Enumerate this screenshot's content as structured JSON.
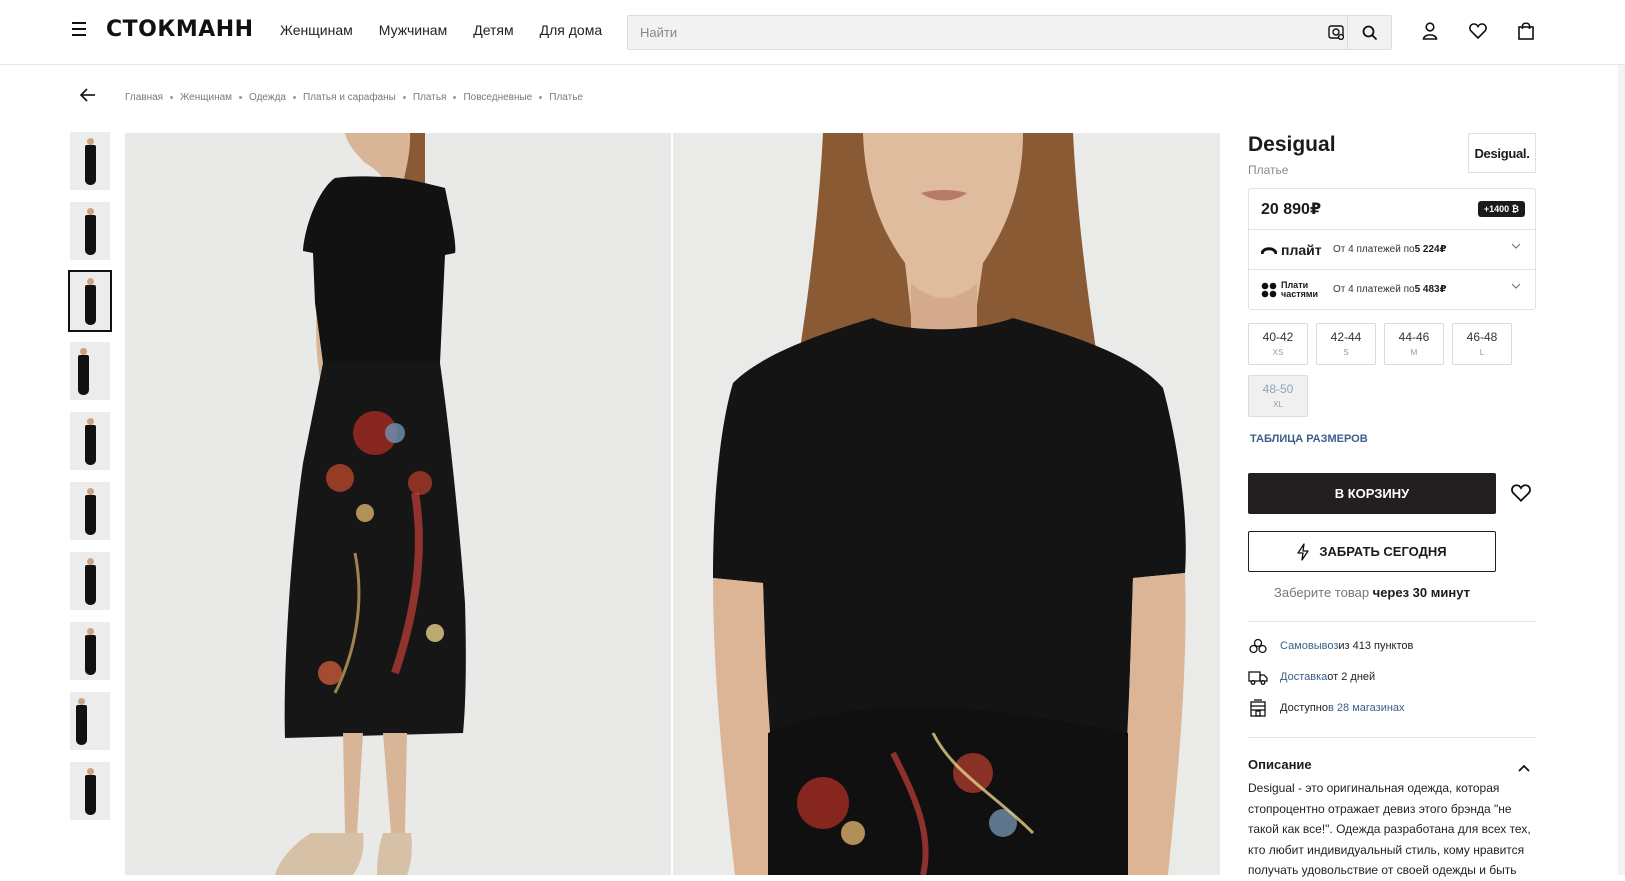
{
  "header": {
    "logo": "СТОКМАНН",
    "nav": [
      "Женщинам",
      "Мужчинам",
      "Детям",
      "Для дома"
    ],
    "search_placeholder": "Найти"
  },
  "breadcrumbs": [
    "Главная",
    "Женщинам",
    "Одежда",
    "Платья и сарафаны",
    "Платья",
    "Повседневные",
    "Платье"
  ],
  "product": {
    "brand": "Desigual",
    "brand_logo": "Desigual.",
    "type": "Платье",
    "price": "20 890₽",
    "bonus": "+1400 ₿",
    "payments": [
      {
        "name": "плайт",
        "text": "От 4 платежей по ",
        "amount": "5 224₽"
      },
      {
        "name_line1": "Плати",
        "name_line2": "частями",
        "text": "От 4 платежей по ",
        "amount": "5 483₽"
      }
    ],
    "sizes": [
      {
        "ru": "40-42",
        "intl": "XS",
        "available": true
      },
      {
        "ru": "42-44",
        "intl": "S",
        "available": true
      },
      {
        "ru": "44-46",
        "intl": "M",
        "available": true
      },
      {
        "ru": "46-48",
        "intl": "L",
        "available": true
      },
      {
        "ru": "48-50",
        "intl": "XL",
        "available": false
      }
    ],
    "size_table": "ТАБЛИЦА РАЗМЕРОВ",
    "cart_button": "В КОРЗИНУ",
    "pickup_button": "ЗАБРАТЬ СЕГОДНЯ",
    "pickup_hint": "Заберите товар ",
    "pickup_hint_bold": "через 30 минут",
    "delivery": [
      {
        "link": "Самовывоз",
        "text": " из 413 пунктов"
      },
      {
        "link": "Доставка",
        "text": " от 2 дней"
      },
      {
        "text": "Доступно ",
        "link": "в 28 магазинах"
      }
    ],
    "description_title": "Описание",
    "description": "Desigual - это оригинальная одежда, которая стопроцентно отражает девиз этого брэнда \"не такой как все!\". Одежда разработана для всех тех, кто любит индивидуальный стиль, кому нравится получать удовольствие от своей одежды и быть"
  },
  "colors": {
    "accent_dark": "#231f20",
    "link": "#3b5f8a"
  }
}
